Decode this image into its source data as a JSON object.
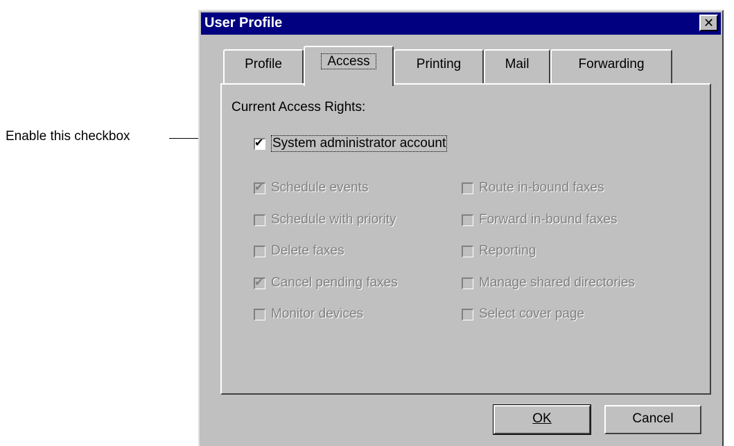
{
  "annotation": {
    "text": "Enable this checkbox"
  },
  "window": {
    "title": "User Profile",
    "close_glyph": "✕",
    "colors": {
      "face": "#c0c0c0",
      "titlebar": "#000080"
    }
  },
  "tabs": [
    {
      "label": "Profile",
      "active": false
    },
    {
      "label": "Access",
      "active": true
    },
    {
      "label": "Printing",
      "active": false
    },
    {
      "label": "Mail",
      "active": false
    },
    {
      "label": "Forwarding",
      "active": false
    }
  ],
  "access": {
    "section_label": "Current Access Rights:",
    "admin": {
      "label": "System administrator account",
      "checked": true,
      "enabled": true
    },
    "left_column": [
      {
        "label": "Schedule events",
        "checked": true,
        "enabled": false
      },
      {
        "label": "Schedule with priority",
        "checked": false,
        "enabled": false
      },
      {
        "label": "Delete faxes",
        "checked": false,
        "enabled": false
      },
      {
        "label": "Cancel pending faxes",
        "checked": true,
        "enabled": false
      },
      {
        "label": "Monitor devices",
        "checked": false,
        "enabled": false
      }
    ],
    "right_column": [
      {
        "label": "Route in-bound faxes",
        "checked": false,
        "enabled": false
      },
      {
        "label": "Forward in-bound faxes",
        "checked": false,
        "enabled": false
      },
      {
        "label": "Reporting",
        "checked": false,
        "enabled": false
      },
      {
        "label": "Manage shared directories",
        "checked": false,
        "enabled": false
      },
      {
        "label": "Select cover page",
        "checked": false,
        "enabled": false
      }
    ]
  },
  "buttons": {
    "ok_label": "OK",
    "cancel_label": "Cancel"
  },
  "icons": {
    "check": "check-mark-icon",
    "close": "close-icon"
  }
}
